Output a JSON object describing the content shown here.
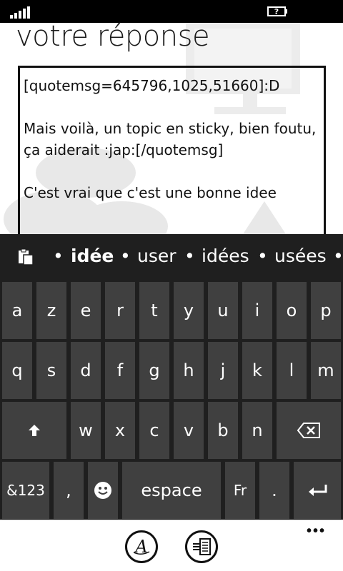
{
  "status_bar": {
    "battery_icon": "battery-unknown-icon"
  },
  "page": {
    "title": "votre réponse"
  },
  "reply": {
    "lines": [
      "[quotemsg=645796,1025,51660]:D",
      "Mais voilà, un topic en sticky, bien foutu, ça aiderait :jap:[/quotemsg]",
      "C'est vrai que c'est une bonne idee"
    ]
  },
  "suggestions": {
    "items": [
      "idée",
      "user",
      "idées",
      "usées"
    ],
    "clipboard_icon": "clipboard-icon"
  },
  "keyboard": {
    "row1": [
      "a",
      "z",
      "e",
      "r",
      "t",
      "y",
      "u",
      "i",
      "o",
      "p"
    ],
    "row2": [
      "q",
      "s",
      "d",
      "f",
      "g",
      "h",
      "j",
      "k",
      "l",
      "m"
    ],
    "row3": [
      "w",
      "x",
      "c",
      "v",
      "b",
      "n"
    ],
    "numbers_label": "&123",
    "comma_label": ",",
    "space_label": "espace",
    "language_label": "Fr",
    "period_label": ".",
    "icons": {
      "shift": "shift-icon",
      "backspace": "backspace-icon",
      "emoji": "emoji-icon",
      "enter": "enter-icon"
    }
  },
  "app_bar": {
    "more_label": "•••",
    "buttons": [
      "text-format-icon",
      "quote-icon"
    ]
  },
  "colors": {
    "keyboard_bg": "#1f1f1f",
    "key_bg": "#404040",
    "text": "#ffffff"
  }
}
